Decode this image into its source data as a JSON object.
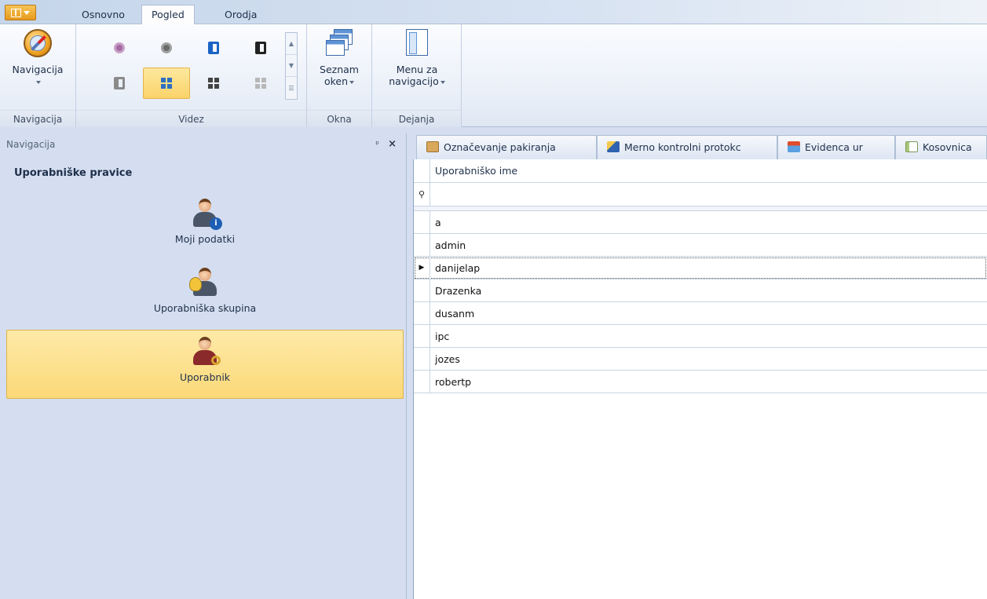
{
  "topbar": {
    "tabs": [
      "Osnovno",
      "Pogled",
      "Orodja"
    ],
    "active_tab": "Pogled"
  },
  "ribbon": {
    "groups": {
      "navigacija": {
        "button_label": "Navigacija",
        "group_label": "Navigacija"
      },
      "videz": {
        "group_label": "Videz"
      },
      "okna": {
        "button_line1": "Seznam",
        "button_line2": "oken",
        "group_label": "Okna"
      },
      "dejanja": {
        "button_line1": "Menu za",
        "button_line2": "navigacijo",
        "group_label": "Dejanja"
      }
    }
  },
  "nav_panel": {
    "header": "Navigacija",
    "pin_glyph": "ᵖ",
    "close_glyph": "×",
    "section_title": "Uporabniške pravice",
    "items": [
      {
        "label": "Moji podatki",
        "icon": "user-info-icon"
      },
      {
        "label": "Uporabniška skupina",
        "icon": "user-group-icon"
      },
      {
        "label": "Uporabnik",
        "icon": "user-key-icon",
        "selected": true
      }
    ]
  },
  "doc_tabs": [
    {
      "label": "Označevanje pakiranja",
      "icon": "package-icon"
    },
    {
      "label": "Merno kontrolni protokc",
      "icon": "pencil-icon"
    },
    {
      "label": "Evidenca ur",
      "icon": "calendar-icon"
    },
    {
      "label": "Kosovnica",
      "icon": "list-icon"
    }
  ],
  "grid": {
    "column_header": "Uporabniško ime",
    "filter_icon": "⚲",
    "rows": [
      "a",
      "admin",
      "danijelap",
      "Drazenka",
      "dusanm",
      "ipc",
      "jozes",
      "robertp"
    ],
    "current_row_marker": "▶",
    "current_row_index": 2
  },
  "colors": {
    "accent_selected": "#fcd978",
    "app_button": "#e79a1d",
    "panel_bg": "#d4def0"
  }
}
